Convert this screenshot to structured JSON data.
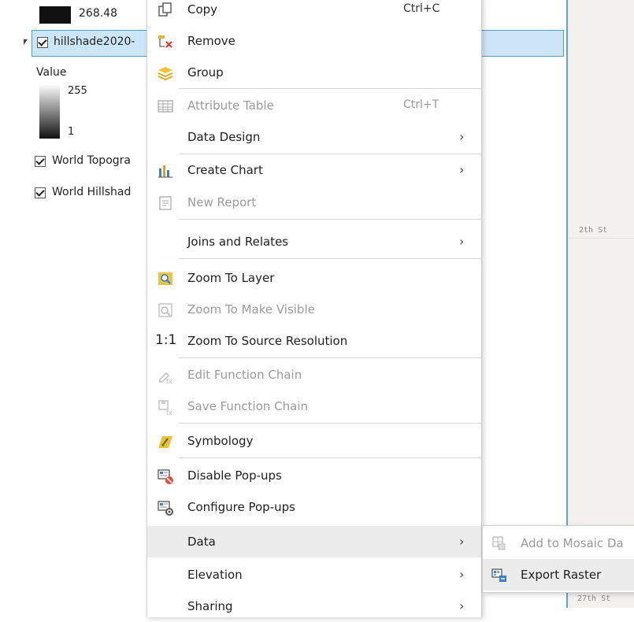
{
  "toc": {
    "top_value": "268.48",
    "layer_name": "hillshade2020-",
    "value_label": "Value",
    "max_value": "255",
    "min_value": "1",
    "layer2": "World Topogra",
    "layer3": "World Hillshad"
  },
  "map": {
    "street1": "2th St",
    "street2": "27th St"
  },
  "menu": {
    "copy": {
      "label": "Copy",
      "shortcut": "Ctrl+C"
    },
    "remove": "Remove",
    "group": "Group",
    "attribute_table": {
      "label": "Attribute Table",
      "shortcut": "Ctrl+T"
    },
    "data_design": "Data Design",
    "create_chart": "Create Chart",
    "new_report": "New Report",
    "joins_relates": "Joins and Relates",
    "zoom_layer": "Zoom To Layer",
    "zoom_visible": "Zoom To Make Visible",
    "zoom_source": "Zoom To Source Resolution",
    "zoom_source_icon_text": "1:1",
    "edit_function": "Edit Function Chain",
    "save_function": "Save Function Chain",
    "symbology": "Symbology",
    "disable_popups": "Disable Pop-ups",
    "configure_popups": "Configure Pop-ups",
    "data": "Data",
    "elevation": "Elevation",
    "sharing": "Sharing",
    "arrow": "›"
  },
  "submenu": {
    "add_mosaic": "Add to Mosaic Da",
    "export_raster": "Export Raster"
  },
  "colors": {
    "selection": "#cde6f7",
    "selection_border": "#4a9ad6",
    "highlight": "#ececec"
  }
}
